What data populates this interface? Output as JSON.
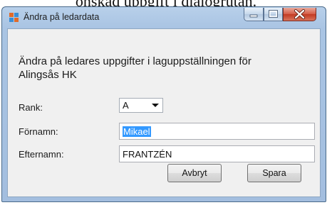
{
  "page": {
    "doc_text_above": "önskad uppgift i dialogrutan."
  },
  "window": {
    "title": "Ändra på ledardata",
    "heading": "Ändra på ledares uppgifter i laguppställningen för Alingsås HK",
    "controls": {
      "minimize": "minimize",
      "maximize": "maximize",
      "close": "close"
    }
  },
  "form": {
    "rank_label": "Rank:",
    "rank_value": "A",
    "firstname_label": "Förnamn:",
    "firstname_value": "Mikael",
    "lastname_label": "Efternamn:",
    "lastname_value": "FRANTZÉN"
  },
  "buttons": {
    "cancel": "Avbryt",
    "save": "Spara"
  },
  "colors": {
    "accent_selection": "#3399ff",
    "close_button": "#c23a22",
    "frame": "#a9c4e3"
  }
}
